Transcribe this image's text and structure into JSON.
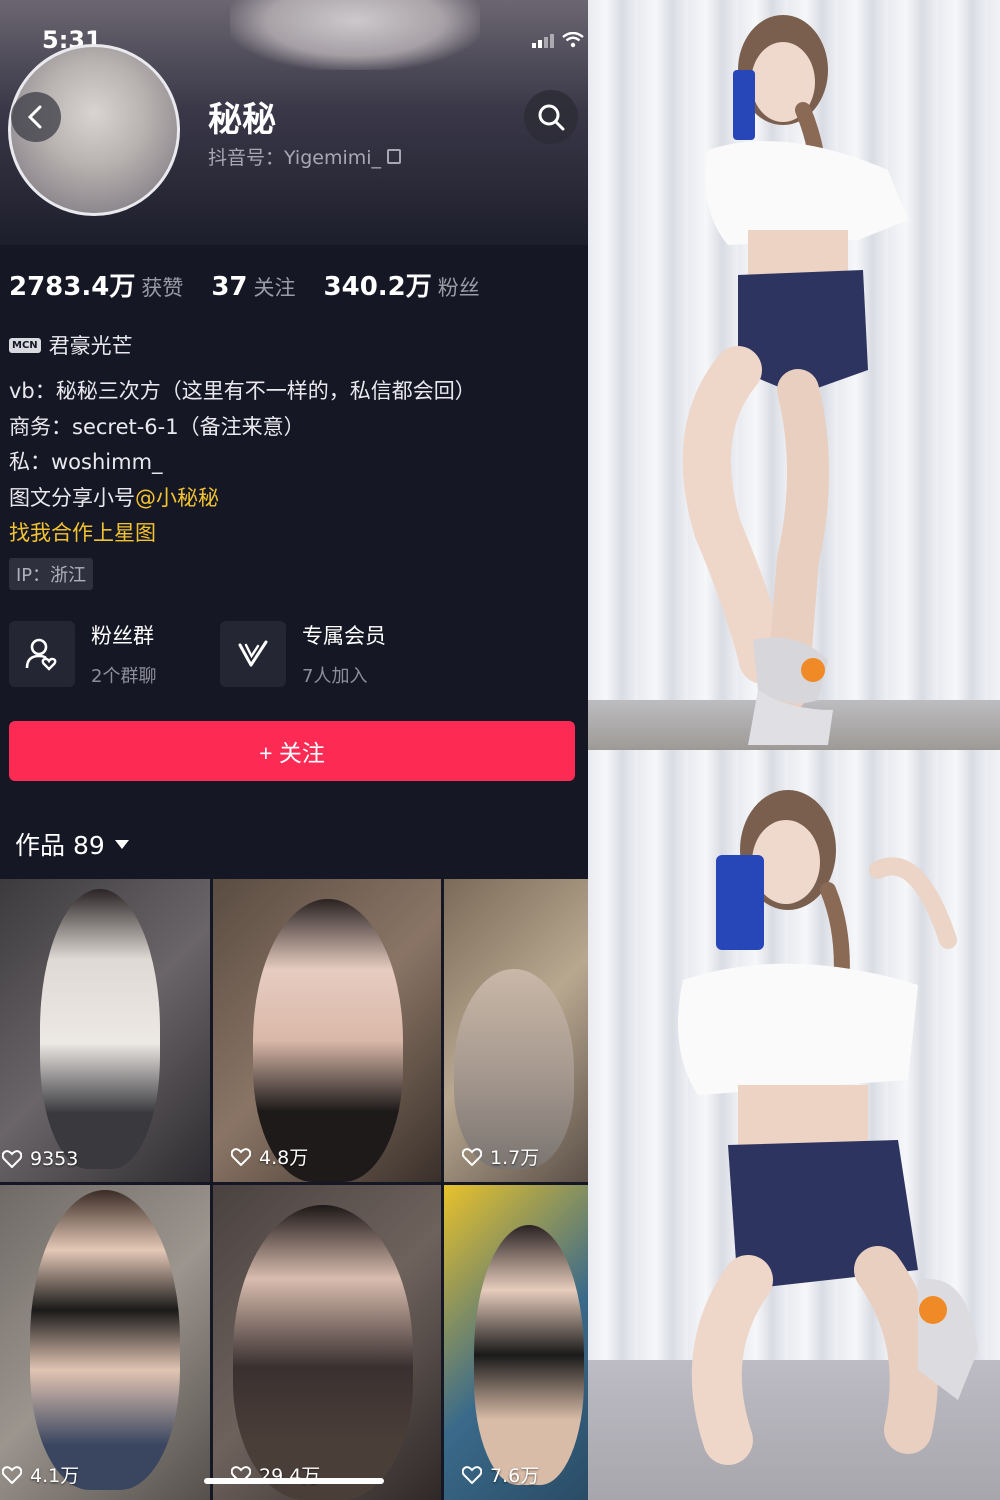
{
  "status_bar": {
    "time": "5:31"
  },
  "profile": {
    "name": "秘秘",
    "handle": "抖音号：Yigemimi_",
    "stats": [
      {
        "value": "2783.4万",
        "label": "获赞"
      },
      {
        "value": "37",
        "label": "关注"
      },
      {
        "value": "340.2万",
        "label": "粉丝"
      }
    ],
    "mcn": {
      "badge": "MCN",
      "name": "君豪光芒"
    },
    "bio_lines": [
      "vb：秘秘三次方（这里有不一样的，私信都会回）",
      "商务：secret-6-1（备注来意）",
      "私：woshimm_"
    ],
    "bio_share_prefix": "图文分享小号",
    "bio_share_mention": "@小秘秘",
    "star_link": "找我合作上星图",
    "ip": "IP：浙江"
  },
  "cards": [
    {
      "title": "粉丝群",
      "subtitle": "2个群聊",
      "icon": "fan-group-icon"
    },
    {
      "title": "专属会员",
      "subtitle": "7人加入",
      "icon": "membership-v-icon"
    }
  ],
  "follow_button": {
    "label": "+ 关注"
  },
  "works": {
    "label": "作品 89"
  },
  "videos": [
    {
      "likes": "9353"
    },
    {
      "likes": "4.8万"
    },
    {
      "likes": "1.7万"
    },
    {
      "likes": "4.1万"
    },
    {
      "likes": "29.4万"
    },
    {
      "likes": "7.6万"
    }
  ],
  "colors": {
    "background": "#161724",
    "accent": "#fd2b54",
    "mention": "#f1c232"
  }
}
